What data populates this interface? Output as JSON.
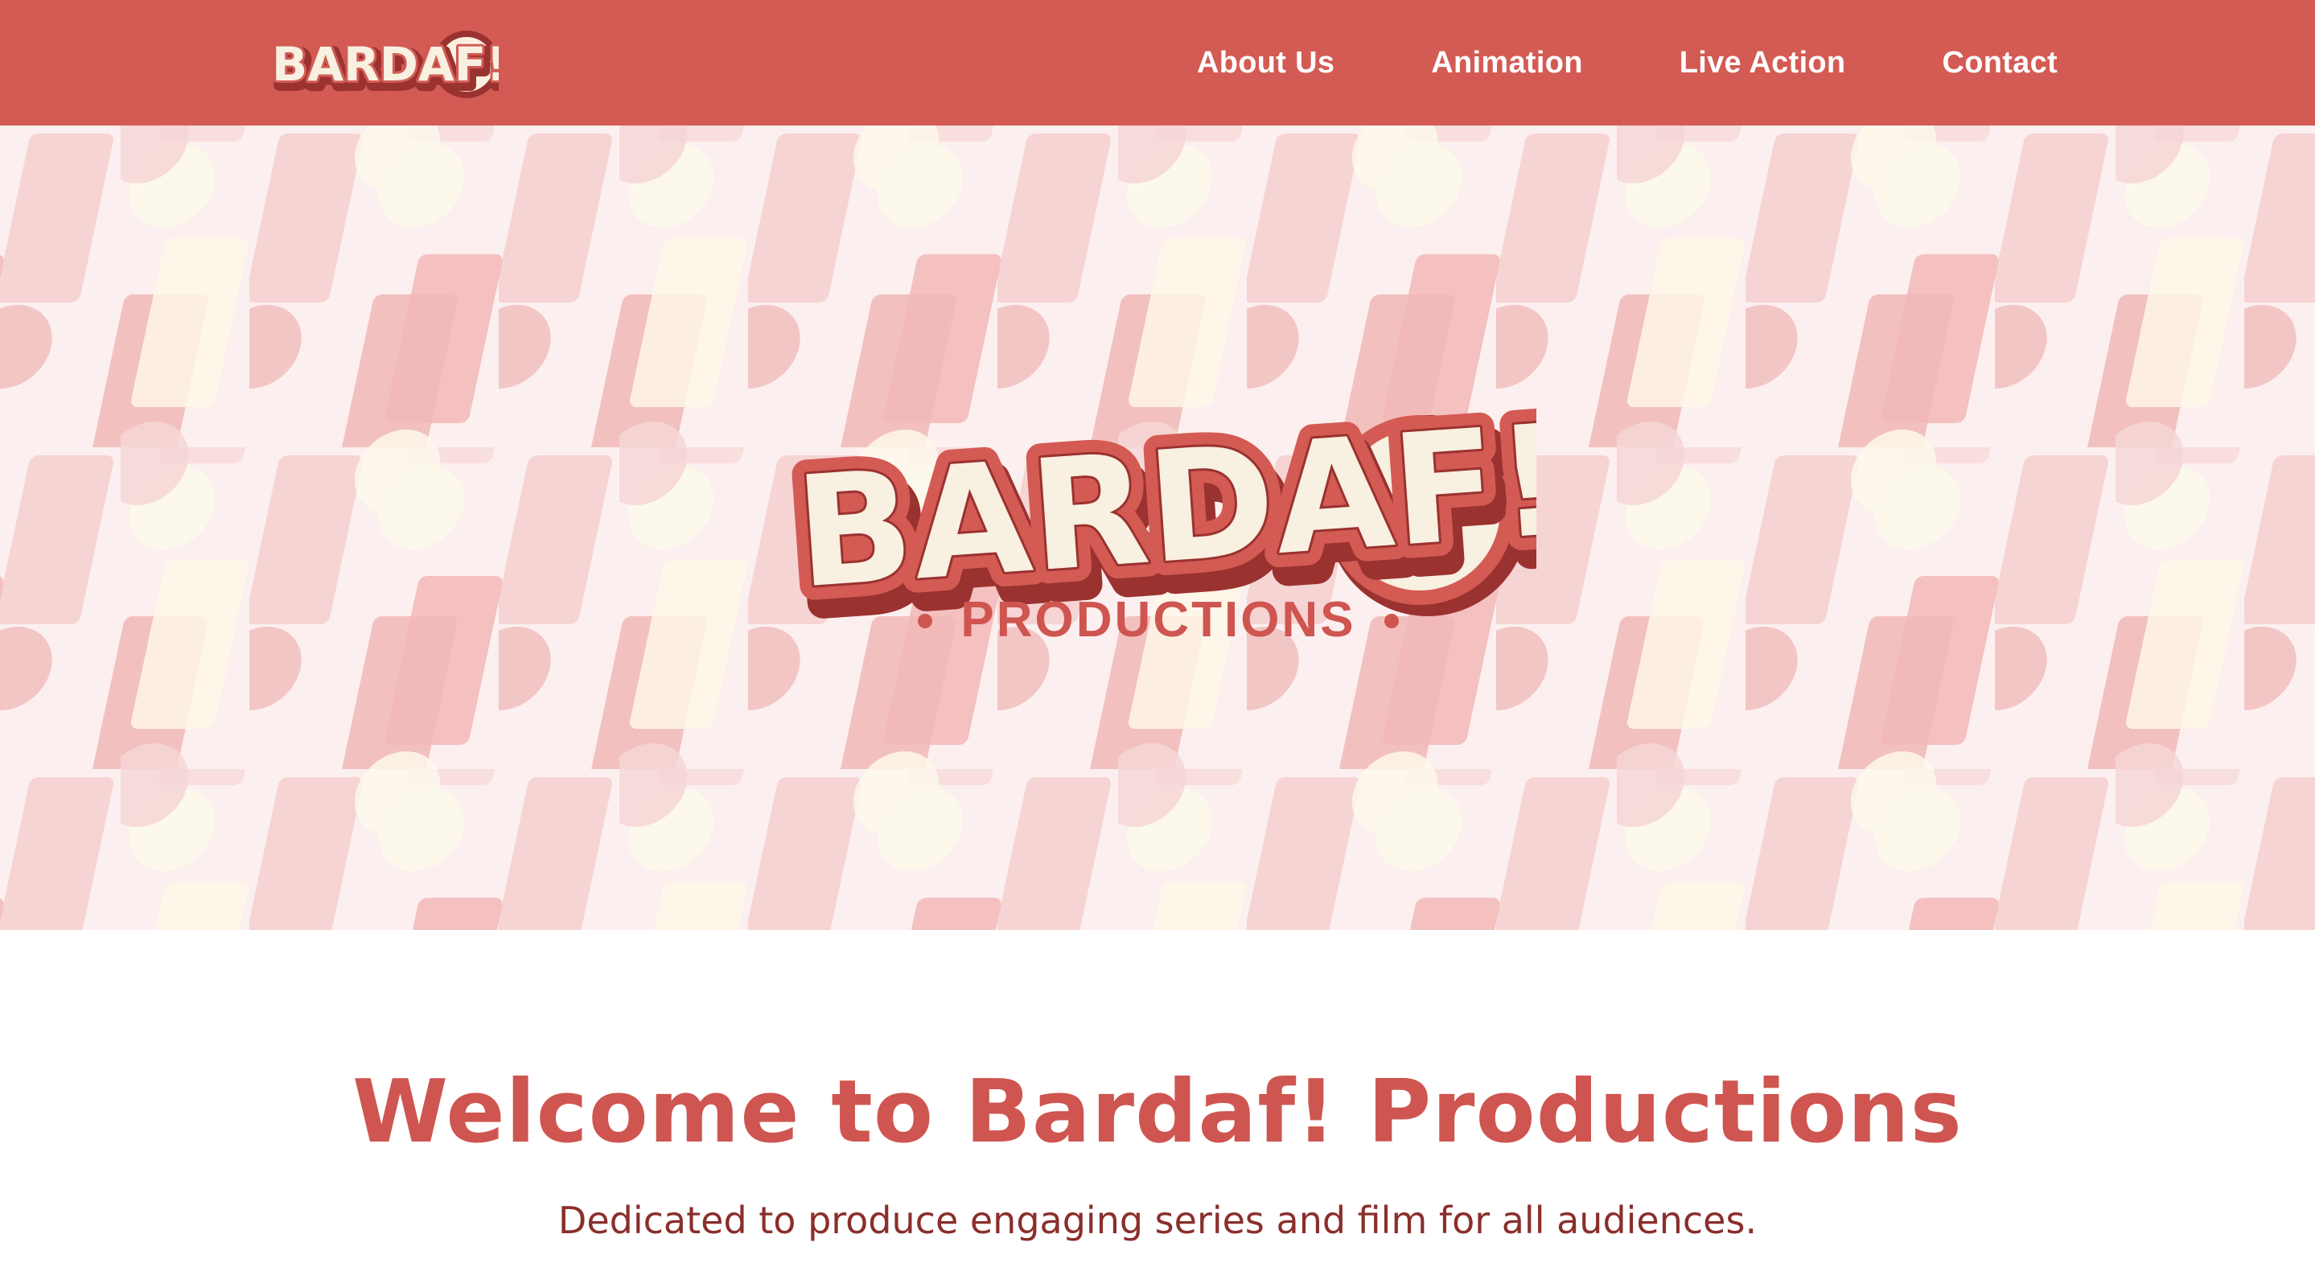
{
  "nav": {
    "logo_text": "BARDAF!",
    "links": [
      {
        "label": "About Us"
      },
      {
        "label": "Animation"
      },
      {
        "label": "Live Action"
      },
      {
        "label": "Contact"
      }
    ]
  },
  "hero": {
    "logo_text": "BARDAF!",
    "logo_subtitle": "PRODUCTIONS"
  },
  "intro": {
    "heading": "Welcome to Bardaf! Productions",
    "tagline": "Dedicated to produce engaging series and film for all audiences."
  },
  "colors": {
    "brand_red": "#d35b54",
    "dark_red": "#9a3230",
    "cream": "#f8f0e0",
    "hero_bg": "#fcefef"
  }
}
